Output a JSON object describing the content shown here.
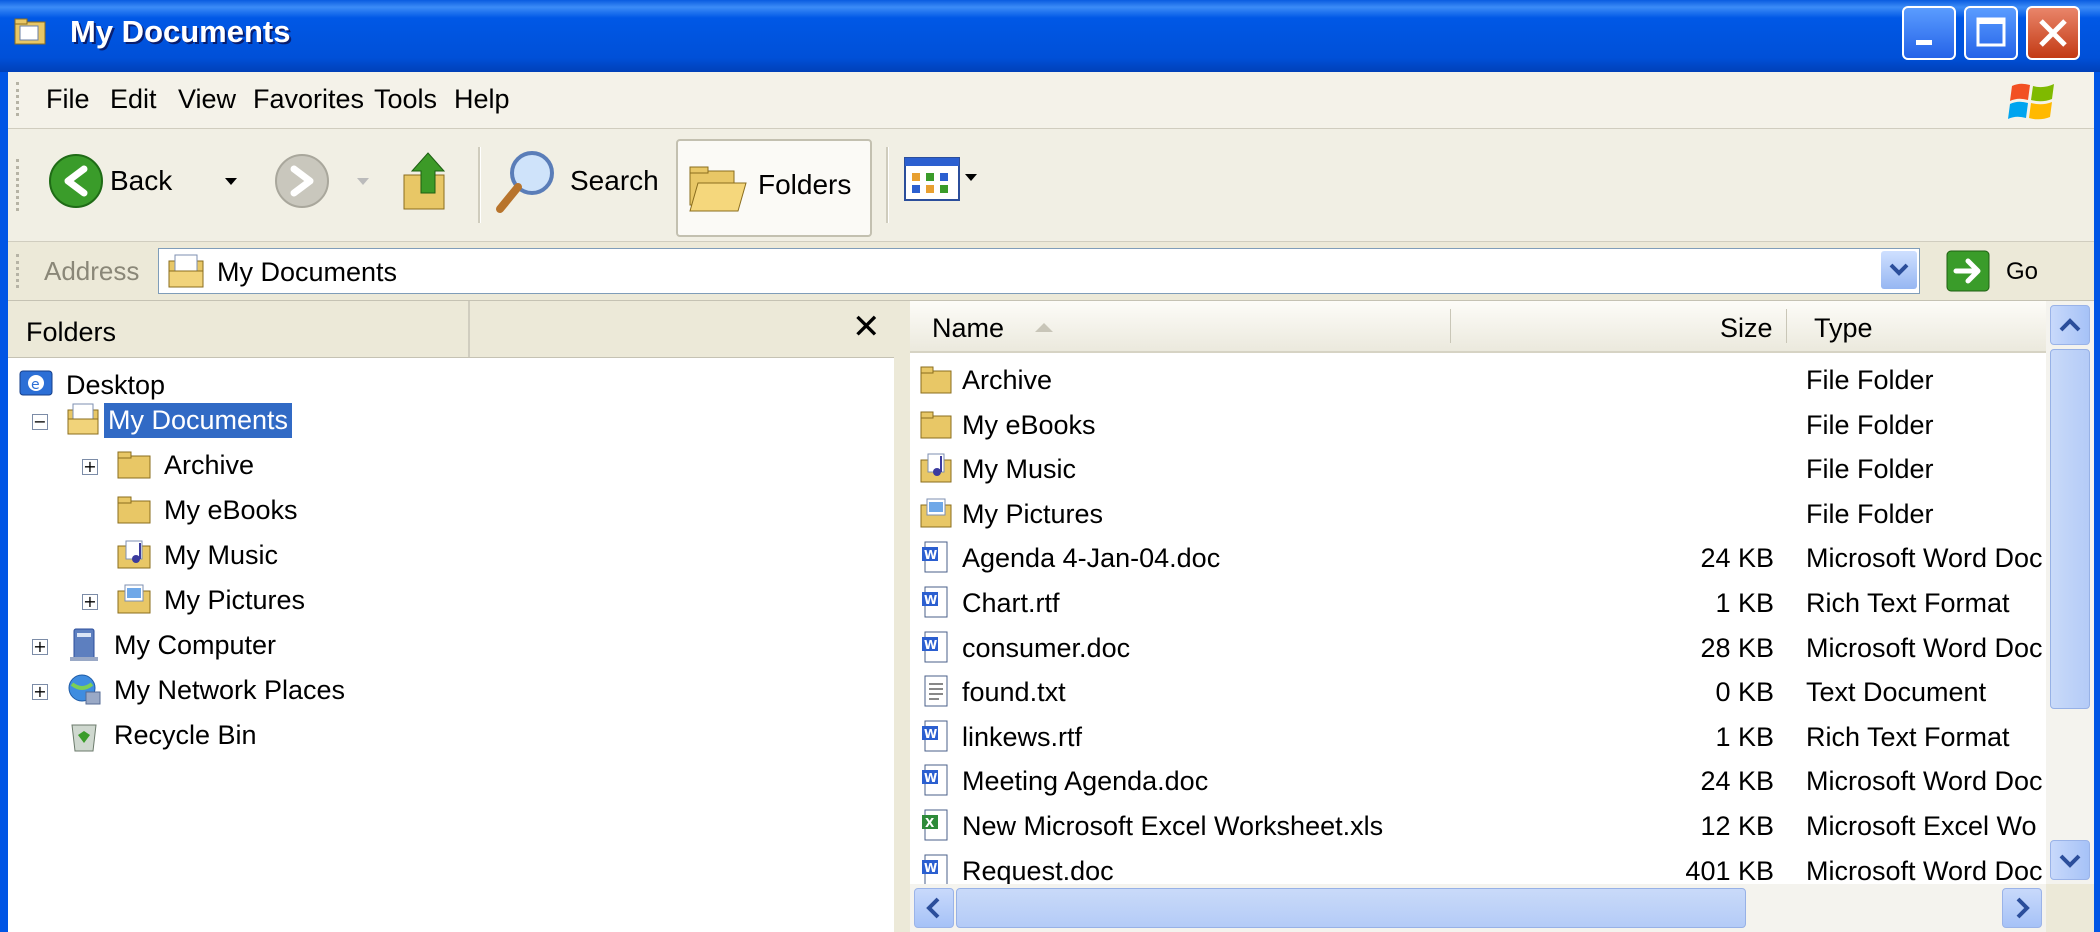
{
  "window": {
    "title": "My Documents"
  },
  "menu": [
    "File",
    "Edit",
    "View",
    "Favorites",
    "Tools",
    "Help"
  ],
  "toolbar": {
    "back_label": "Back",
    "search_label": "Search",
    "folders_label": "Folders"
  },
  "address": {
    "label": "Address",
    "value": "My Documents",
    "go_label": "Go"
  },
  "folders_pane": {
    "title": "Folders",
    "close_glyph": "✕",
    "tree": [
      {
        "label": "Desktop",
        "icon": "desktop-icon"
      },
      {
        "label": "My Documents",
        "icon": "my-documents-icon",
        "selected": true,
        "expander": "−"
      },
      {
        "label": "Archive",
        "icon": "folder-icon",
        "expander": "+"
      },
      {
        "label": "My eBooks",
        "icon": "folder-icon"
      },
      {
        "label": "My Music",
        "icon": "music-folder-icon"
      },
      {
        "label": "My Pictures",
        "icon": "pictures-folder-icon",
        "expander": "+"
      },
      {
        "label": "My Computer",
        "icon": "computer-icon",
        "expander": "+"
      },
      {
        "label": "My Network Places",
        "icon": "network-icon",
        "expander": "+"
      },
      {
        "label": "Recycle Bin",
        "icon": "recycle-bin-icon"
      }
    ]
  },
  "file_list": {
    "columns": {
      "name": "Name",
      "size": "Size",
      "type": "Type"
    },
    "rows": [
      {
        "name": "Archive",
        "size": "",
        "type": "File Folder",
        "icon": "folder-icon"
      },
      {
        "name": "My eBooks",
        "size": "",
        "type": "File Folder",
        "icon": "folder-icon"
      },
      {
        "name": "My Music",
        "size": "",
        "type": "File Folder",
        "icon": "music-folder-icon"
      },
      {
        "name": "My Pictures",
        "size": "",
        "type": "File Folder",
        "icon": "pictures-folder-icon"
      },
      {
        "name": "Agenda 4-Jan-04.doc",
        "size": "24 KB",
        "type": "Microsoft Word Doc",
        "icon": "word-doc-icon"
      },
      {
        "name": "Chart.rtf",
        "size": "1 KB",
        "type": "Rich Text Format",
        "icon": "word-doc-icon"
      },
      {
        "name": "consumer.doc",
        "size": "28 KB",
        "type": "Microsoft Word Doc",
        "icon": "word-doc-icon"
      },
      {
        "name": "found.txt",
        "size": "0 KB",
        "type": "Text Document",
        "icon": "text-file-icon"
      },
      {
        "name": "linkews.rtf",
        "size": "1 KB",
        "type": "Rich Text Format",
        "icon": "word-doc-icon"
      },
      {
        "name": "Meeting Agenda.doc",
        "size": "24 KB",
        "type": "Microsoft Word Doc",
        "icon": "word-doc-icon"
      },
      {
        "name": "New Microsoft Excel Worksheet.xls",
        "size": "12 KB",
        "type": "Microsoft Excel Wo",
        "icon": "excel-icon"
      },
      {
        "name": "Request.doc",
        "size": "401 KB",
        "type": "Microsoft Word Doc",
        "icon": "word-doc-icon"
      }
    ]
  },
  "colors": {
    "titlebar": "#0055e5",
    "selection": "#316ac5",
    "chrome": "#ece9d8"
  }
}
